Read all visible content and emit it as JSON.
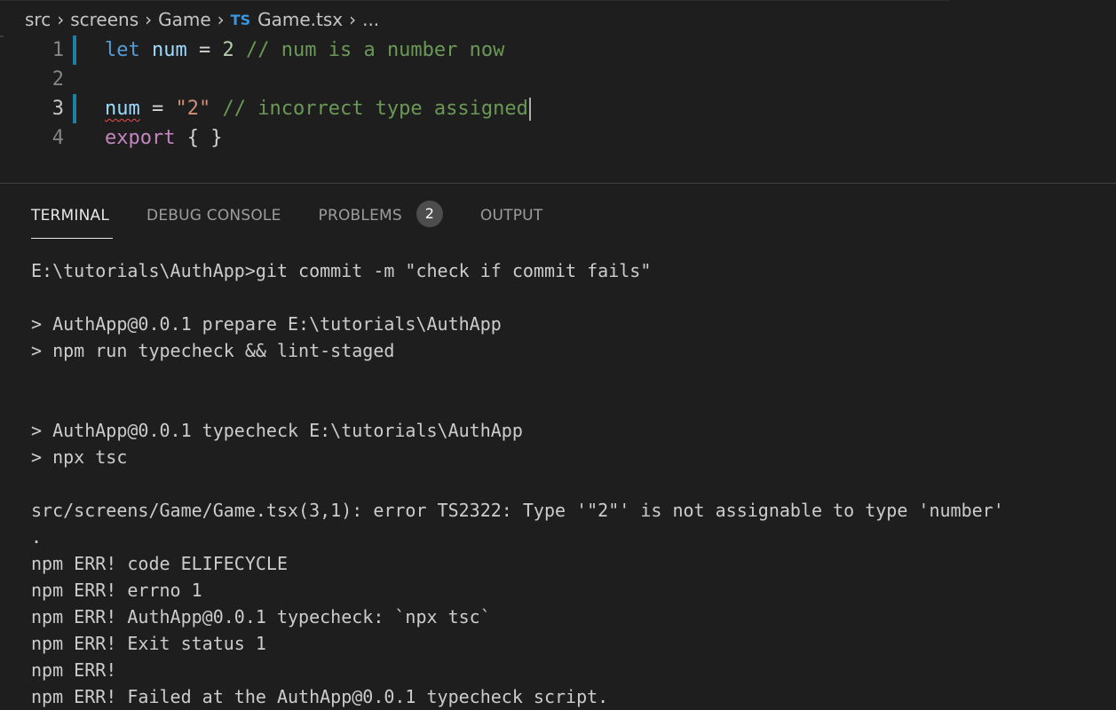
{
  "breadcrumb": {
    "items": [
      "src",
      "screens",
      "Game"
    ],
    "file_badge": "TS",
    "file_name": "Game.tsx",
    "ellipsis": "..."
  },
  "editor": {
    "line_numbers": [
      "1",
      "2",
      "3",
      "4"
    ],
    "line1": {
      "kw": "let",
      "var": "num",
      "op": "=",
      "num": "2",
      "comment": "// num is a number now"
    },
    "line3": {
      "var": "num",
      "op": "=",
      "str": "\"2\"",
      "comment": "// incorrect type assigned"
    },
    "line4": {
      "kw": "export",
      "braces": "{ }"
    }
  },
  "panel": {
    "tabs": {
      "terminal": "TERMINAL",
      "debug_console": "DEBUG CONSOLE",
      "problems": "PROBLEMS",
      "problems_count": "2",
      "output": "OUTPUT"
    },
    "active_tab": "TERMINAL"
  },
  "terminal": {
    "lines": [
      "E:\\tutorials\\AuthApp>git commit -m \"check if commit fails\"",
      "",
      "> AuthApp@0.0.1 prepare E:\\tutorials\\AuthApp",
      "> npm run typecheck && lint-staged",
      "",
      "",
      "> AuthApp@0.0.1 typecheck E:\\tutorials\\AuthApp",
      "> npx tsc",
      "",
      "src/screens/Game/Game.tsx(3,1): error TS2322: Type '\"2\"' is not assignable to type 'number'",
      ".",
      "npm ERR! code ELIFECYCLE",
      "npm ERR! errno 1",
      "npm ERR! AuthApp@0.0.1 typecheck: `npx tsc`",
      "npm ERR! Exit status 1",
      "npm ERR!",
      "npm ERR! Failed at the AuthApp@0.0.1 typecheck script."
    ]
  },
  "colors": {
    "background": "#1e1e1e",
    "keyword": "#569cd6",
    "variable": "#9cdcfe",
    "number": "#b5cea8",
    "string": "#ce9178",
    "comment": "#6a9955",
    "gutter_marker": "#1b81a8",
    "error_squiggle": "#f14c4c"
  }
}
